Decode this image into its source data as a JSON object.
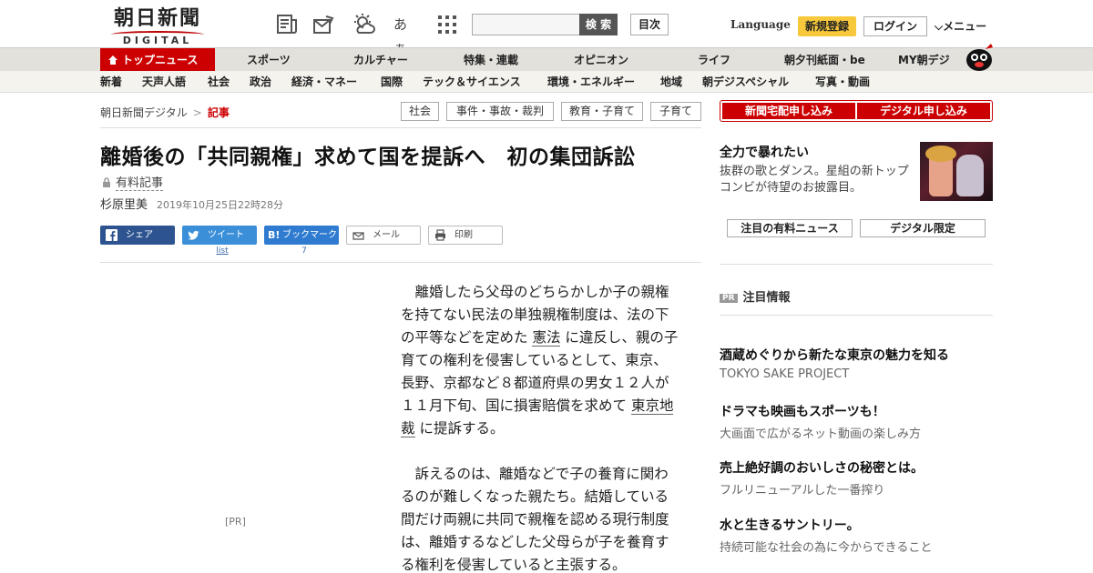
{
  "header": {
    "logo_jp": "朝日新聞",
    "logo_en": "DIGITAL",
    "search_button": "検 索",
    "mokuji_button": "目次",
    "language": "Language",
    "register_button": "新規登録",
    "login_button": "ログイン",
    "menu_button": "メニュー",
    "icons": [
      "newspaper-icon",
      "mail-icon",
      "weather-icon",
      "font-size-icon",
      "grid-icon"
    ],
    "font_size_glyph": "あぁ"
  },
  "nav_main": {
    "active": "トップニュース",
    "items": [
      "スポーツ",
      "カルチャー",
      "特集・連載",
      "オピニオン",
      "ライフ",
      "朝夕刊紙面・be",
      "MY朝デジ"
    ]
  },
  "nav_sub": {
    "items": [
      "新着",
      "天声人語",
      "社会",
      "政治",
      "経済・マネー",
      "国際",
      "テック＆サイエンス",
      "環境・エネルギー",
      "地域",
      "朝デジスペシャル",
      "写真・動画"
    ]
  },
  "breadcrumb": {
    "home": "朝日新聞デジタル",
    "sep": ">",
    "current": "記事"
  },
  "tags": [
    "社会",
    "事件・事故・裁判",
    "教育・子育て",
    "子育て"
  ],
  "article": {
    "title": "離婚後の「共同親権」求めて国を提訴へ　初の集団訴訟",
    "paid_label": "有料記事",
    "author": "杉原里美",
    "date": "2019年10月25日22時28分",
    "share": {
      "facebook": "シェア",
      "twitter": "ツイート",
      "twitter_count": "list",
      "hatena": "ブックマーク",
      "hatena_count": "7",
      "mail": "メール",
      "print": "印刷"
    },
    "ad_label": "[PR]",
    "p1_a": "離婚したら父母のどちらかしか子の親権を持てない民法の単独親権制度は、法の下の平等などを定めた ",
    "p1_link1": "憲法",
    "p1_b": " に違反し、親の子育ての権利を侵害しているとして、東京、長野、京都など８都道府県の男女１２人が１１月下旬、国に損害賠償を求めて ",
    "p1_link2": "東京地裁",
    "p1_c": " に提訴する。",
    "p2": "訴えるのは、離婚などで子の養育に関わるのが難しくなった親たち。結婚している間だけ両親に共同で親権を認める現行制度は、離婚するなどした父母らが子を養育する権利を侵害していると主張する。"
  },
  "sidebar": {
    "order_newspaper": "新聞宅配申し込み",
    "order_digital": "デジタル申し込み",
    "promo": {
      "title": "全力で暴れたい",
      "text": "抜群の歌とダンス。星組の新トップコンビが待望のお披露目。"
    },
    "tabs": [
      "注目の有料ニュース",
      "デジタル限定"
    ],
    "pr_badge": "PR",
    "pr_heading": "注目情報",
    "pr_items": [
      {
        "title": "酒蔵めぐりから新たな東京の魅力を知る",
        "sub": "TOKYO SAKE PROJECT"
      },
      {
        "title": "ドラマも映画もスポーツも！",
        "sub": "大画面で広がるネット動画の楽しみ方"
      },
      {
        "title": "売上絶好調のおいしさの秘密とは。",
        "sub": "フルリニューアルした一番搾り"
      },
      {
        "title": "水と生きるサントリー。",
        "sub": "持続可能な社会の為に今からできること"
      }
    ]
  },
  "colors": {
    "brand_red": "#cc0000",
    "register_yellow": "#f7c83b",
    "facebook": "#2d5491",
    "twitter": "#3b8fd8"
  }
}
